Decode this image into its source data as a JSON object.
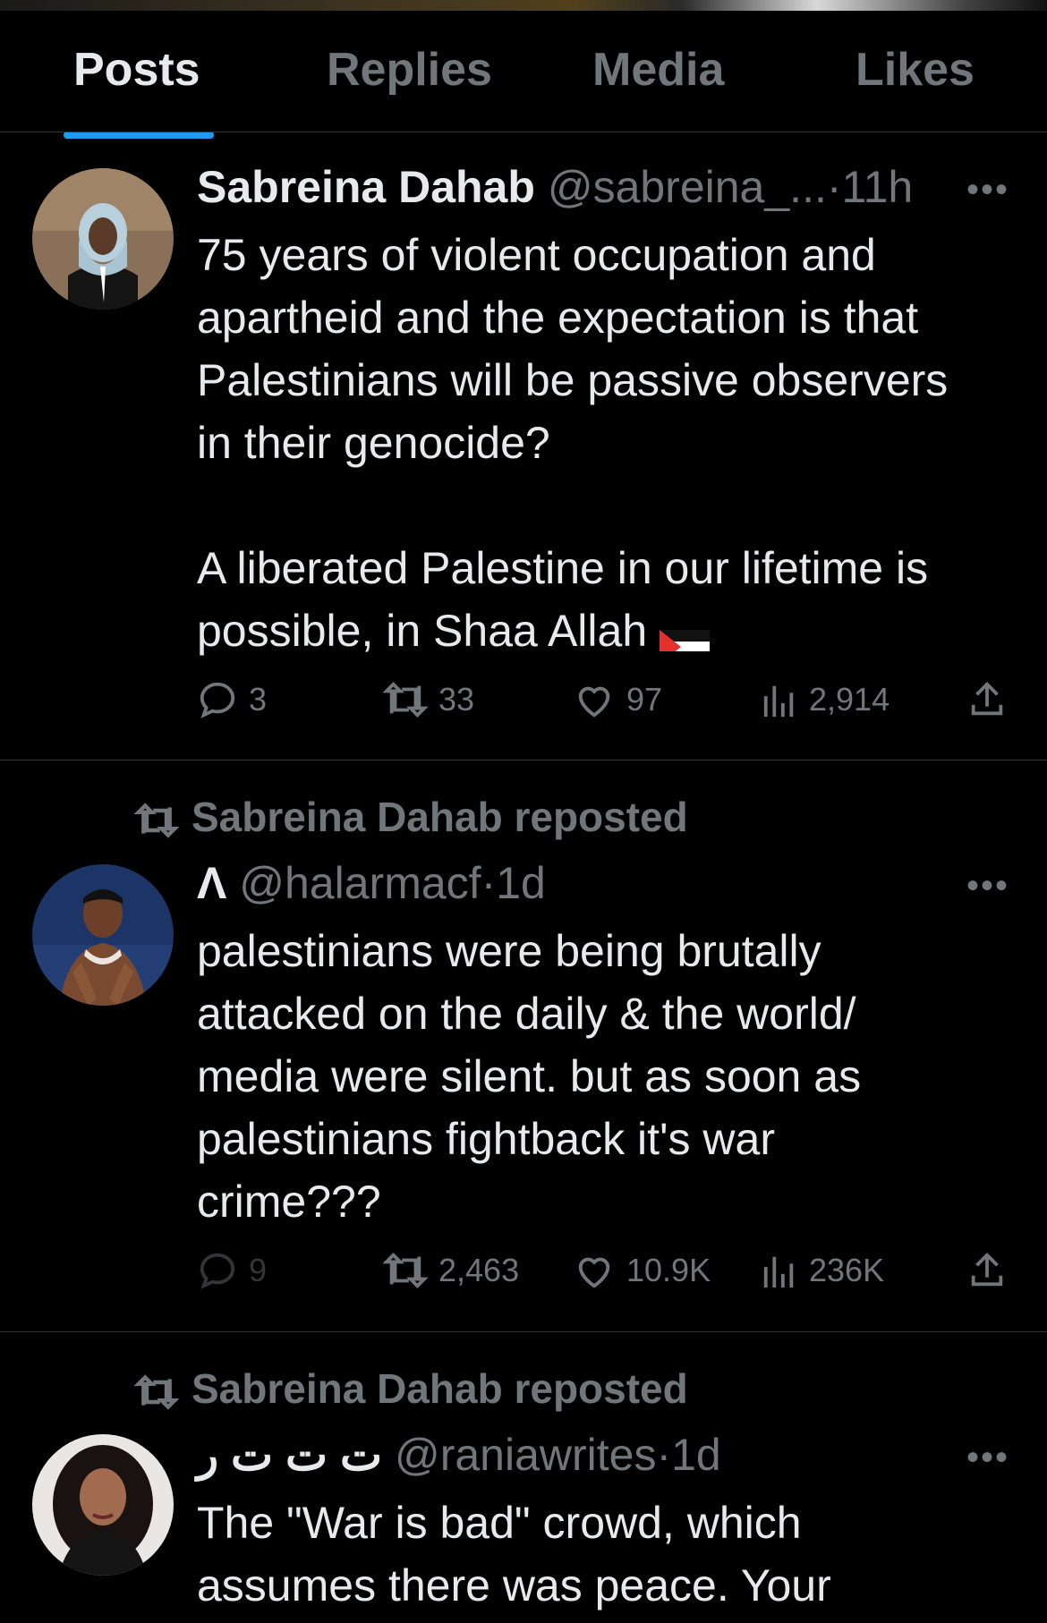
{
  "tabs": {
    "posts": "Posts",
    "replies": "Replies",
    "media": "Media",
    "likes": "Likes"
  },
  "posts": [
    {
      "name": "Sabreina Dahab",
      "handle": "@sabreina_...",
      "time": "11h",
      "body": [
        "75 years of violent occupation and",
        "apartheid and the expectation is that",
        "Palestinians will be passive observers",
        "in their genocide?",
        "",
        "A liberated Palestine in our lifetime is",
        "possible, in Shaa Allah"
      ],
      "replies": "3",
      "reposts": "33",
      "likes": "97",
      "views": "2,914"
    },
    {
      "repost_label": "Sabreina Dahab reposted",
      "name": "Λ",
      "handle": "@halarmacf",
      "time": "1d",
      "body": [
        "palestinians were being brutally",
        "attacked on the daily & the world/",
        "media were silent. but as soon as",
        "palestinians fightback it's war",
        "crime???"
      ],
      "replies": "9",
      "reposts": "2,463",
      "likes": "10.9K",
      "views": "236K"
    },
    {
      "repost_label": "Sabreina Dahab reposted",
      "name": "ت ت ت ر",
      "handle": "@raniawrites",
      "time": "1d",
      "body": [
        "The \"War is bad\" crowd, which",
        "assumes there was peace. Your"
      ]
    }
  ],
  "colors": {
    "background": "#000000",
    "text": "#e7e9ea",
    "muted": "#71767b",
    "accent": "#1d9bf0",
    "divider": "#2f3336"
  }
}
